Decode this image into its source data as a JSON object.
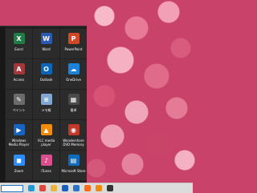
{
  "start_menu": {
    "tiles": [
      {
        "label": "Excel",
        "icon": "excel-icon",
        "color": "#1d7d45",
        "glyph": "X"
      },
      {
        "label": "Word",
        "icon": "word-icon",
        "color": "#2b5ab4",
        "glyph": "W"
      },
      {
        "label": "PowerPoint",
        "icon": "powerpoint-icon",
        "color": "#d24726",
        "glyph": "P"
      },
      {
        "label": "Access",
        "icon": "access-icon",
        "color": "#a4373a",
        "glyph": "A"
      },
      {
        "label": "Outlook",
        "icon": "outlook-icon",
        "color": "#0a64b7",
        "glyph": "O"
      },
      {
        "label": "OneDrive",
        "icon": "onedrive-icon",
        "color": "#1a82d8",
        "glyph": "☁"
      },
      {
        "label": "ペイント",
        "icon": "paint-icon",
        "color": "#6b6b6b",
        "glyph": "✎"
      },
      {
        "label": "メモ帳",
        "icon": "notepad-icon",
        "color": "#7fa7d0",
        "glyph": "≡"
      },
      {
        "label": "電卓",
        "icon": "calculator-icon",
        "color": "#4a4a4a",
        "glyph": "▦"
      },
      {
        "label": "Windows Media Player",
        "icon": "media-player-icon",
        "color": "#1565c0",
        "glyph": "▶"
      },
      {
        "label": "VLC media player",
        "icon": "vlc-icon",
        "color": "#f28a0a",
        "glyph": "▲"
      },
      {
        "label": "Wondershare DVD Memory",
        "icon": "dvd-memory-icon",
        "color": "#c0392b",
        "glyph": "◉"
      },
      {
        "label": "Zoom",
        "icon": "zoom-icon",
        "color": "#2d8cff",
        "glyph": "◼"
      },
      {
        "label": "iTunes",
        "icon": "itunes-icon",
        "color": "#d94f8c",
        "glyph": "♪"
      },
      {
        "label": "Microsoft Store",
        "icon": "store-icon",
        "color": "#0f6cbd",
        "glyph": "▤"
      }
    ]
  },
  "taskbar": {
    "icons": [
      {
        "name": "edge-icon",
        "color": "#1f9ad6"
      },
      {
        "name": "chrome-icon",
        "color": "#e0463a"
      },
      {
        "name": "file-explorer-icon",
        "color": "#e8b43a"
      },
      {
        "name": "mail-icon",
        "color": "#1560bd"
      },
      {
        "name": "store-taskbar-icon",
        "color": "#2b72c9"
      },
      {
        "name": "firefox-icon",
        "color": "#ff6a13"
      },
      {
        "name": "vlc-taskbar-icon",
        "color": "#f28a0a"
      },
      {
        "name": "app-taskbar-icon",
        "color": "#333333"
      }
    ]
  }
}
